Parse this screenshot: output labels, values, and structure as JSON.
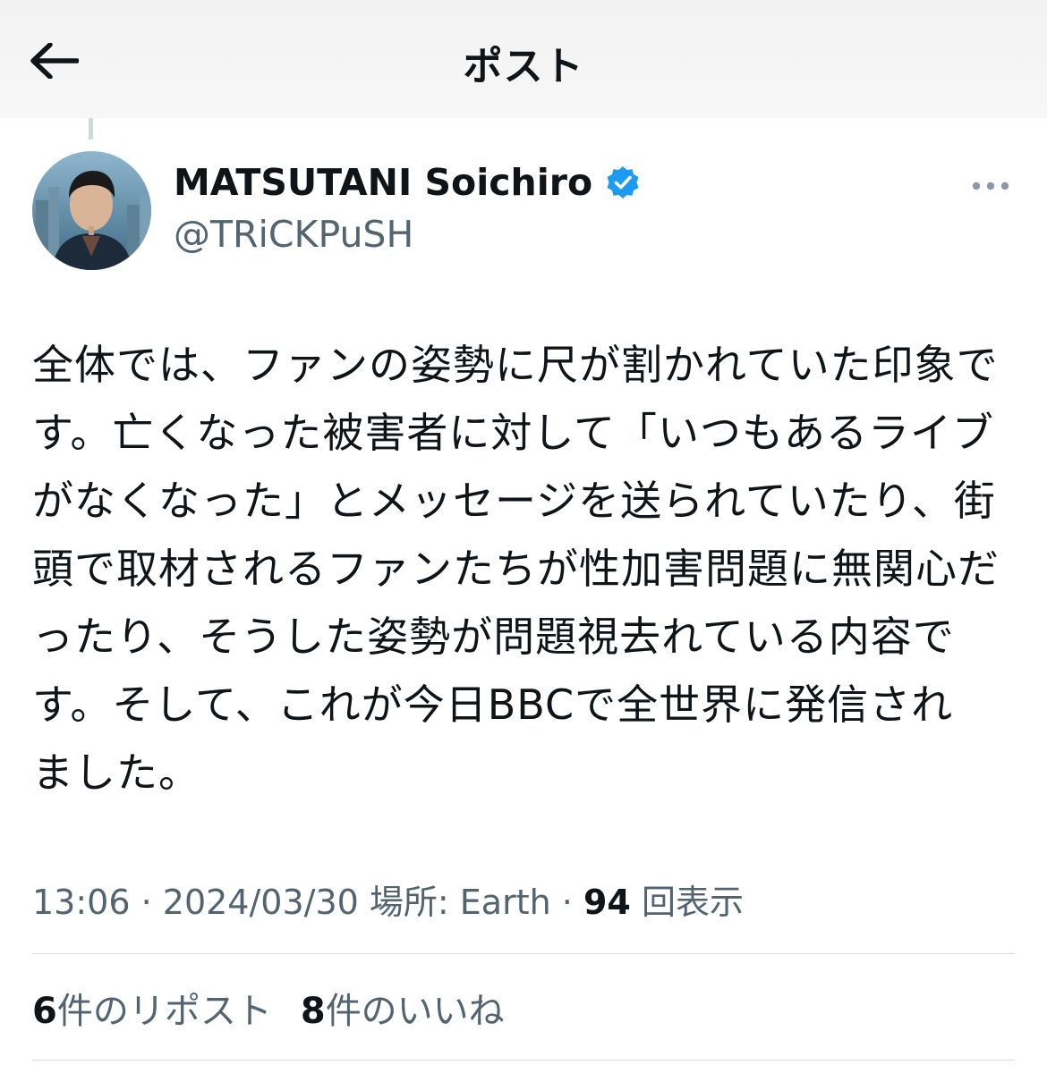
{
  "header": {
    "title": "ポスト",
    "back_icon": "arrow-left-icon"
  },
  "author": {
    "display_name": "MATSUTANI Soichiro",
    "handle": "@TRiCKPuSH",
    "verified_icon": "verified-badge-icon",
    "verified_color": "#1d9bf0"
  },
  "more_icon": "more-horizontal-icon",
  "tweet": {
    "text": "全体では、ファンの姿勢に尺が割かれていた印象で\nす。亡くなった被害者に対して「いつもあるライブ\nがなくなった」とメッセージを送られていたり、街\n頭で取材されるファンたちが性加害問題に無関心だ\nったり、そうした姿勢が問題視去れている内容で\nす。そして、これが今日BBCで全世界に発信され\nました。"
  },
  "meta": {
    "time": "13:06",
    "date": "2024/03/30",
    "location": "場所: Earth",
    "views_count": "94",
    "views_label": "回表示"
  },
  "stats": {
    "reposts_count": "6",
    "reposts_label": "件のリポスト",
    "likes_count": "8",
    "likes_label": "件のいいね"
  }
}
